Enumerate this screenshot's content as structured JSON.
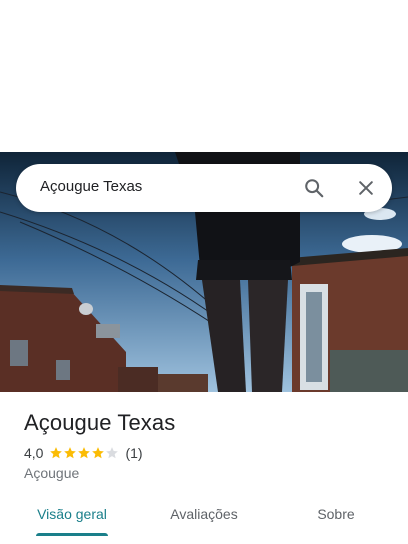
{
  "search": {
    "query": "Açougue Texas"
  },
  "place": {
    "title": "Açougue Texas",
    "rating": "4,0",
    "stars_filled": 4,
    "stars_total": 5,
    "review_count": "(1)",
    "category": "Açougue"
  },
  "tabs": [
    {
      "label": "Visão geral",
      "active": true
    },
    {
      "label": "Avaliações",
      "active": false
    },
    {
      "label": "Sobre",
      "active": false
    }
  ],
  "colors": {
    "accent": "#1a7f8a",
    "star": "#fbbc04",
    "star_empty": "#dadce0"
  },
  "icons": {
    "search": "search-icon",
    "close": "close-icon",
    "star": "star-icon"
  }
}
